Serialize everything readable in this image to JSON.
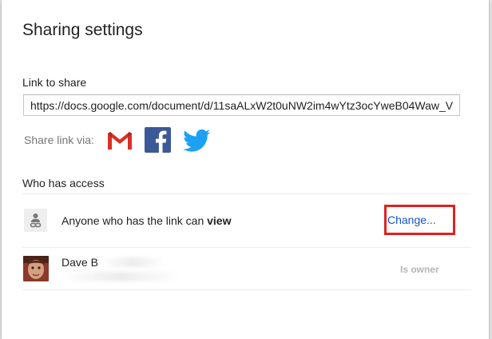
{
  "dialog": {
    "title": "Sharing settings"
  },
  "link_section": {
    "label": "Link to share",
    "url": "https://docs.google.com/document/d/11saALxW2t0uNW2im4wYtz3ocYweB04Waw_V"
  },
  "share_via": {
    "label": "Share link via:",
    "services": [
      {
        "icon": "gmail-icon",
        "color": "#d93025"
      },
      {
        "icon": "facebook-icon",
        "color": "#3b5998"
      },
      {
        "icon": "twitter-icon",
        "color": "#1da1f2"
      }
    ]
  },
  "access": {
    "label": "Who has access",
    "link_rule": {
      "prefix": "Anyone who has the link can ",
      "permission": "view",
      "action": "Change..."
    },
    "people": [
      {
        "name": "Dave B",
        "role": "Is owner"
      }
    ]
  },
  "colors": {
    "link": "#1155cc",
    "highlight": "#e02020"
  }
}
